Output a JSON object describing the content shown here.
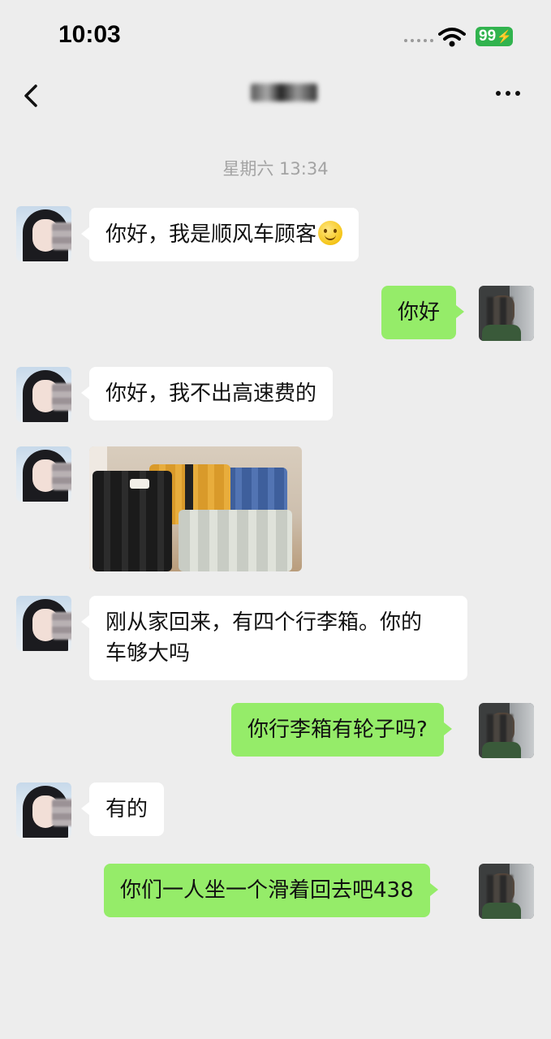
{
  "status_bar": {
    "time": "10:03",
    "battery": "99"
  },
  "nav": {
    "back_icon": "chevron-left-icon",
    "more_icon": "more-dots-icon"
  },
  "chat": {
    "timestamp": "星期六 13:34",
    "messages": [
      {
        "side": "left",
        "text": "你好，我是顺风车顾客"
      },
      {
        "side": "right",
        "text": "你好"
      },
      {
        "side": "left",
        "text": "你好，我不出高速费的"
      },
      {
        "side": "left",
        "type": "image",
        "description": "suitcases"
      },
      {
        "side": "left",
        "text": "刚从家回来，有四个行李箱。你的\n车够大吗"
      },
      {
        "side": "right",
        "text": "你行李箱有轮子吗?"
      },
      {
        "side": "left",
        "text": "有的"
      },
      {
        "side": "right",
        "text": "你们一人坐一个滑着回去吧438"
      }
    ]
  },
  "colors": {
    "background": "#ededed",
    "bubble_self": "#95ec69",
    "bubble_other": "#ffffff",
    "battery": "#31b34e"
  }
}
